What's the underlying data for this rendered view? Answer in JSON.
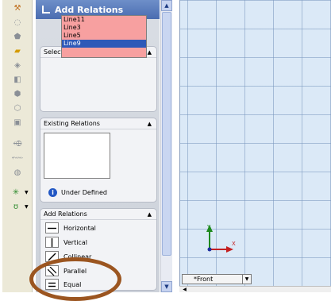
{
  "property_manager": {
    "title": "Add Relations",
    "buttons": {
      "ok": "✓",
      "help": "?",
      "detailed": "@"
    },
    "selected_entities": {
      "heading": "Selected Entities",
      "items": [
        "Line11",
        "Line3",
        "Line5",
        "Line9"
      ],
      "active_index": 3
    },
    "existing_relations": {
      "heading": "Existing Relations",
      "status": "Under Defined"
    },
    "add_relations": {
      "heading": "Add Relations",
      "items": [
        {
          "label": "Horizontal",
          "icon": "horizontal-line-icon"
        },
        {
          "label": "Vertical",
          "icon": "vertical-line-icon"
        },
        {
          "label": "Collinear",
          "icon": "collinear-icon"
        },
        {
          "label": "Parallel",
          "icon": "parallel-icon"
        },
        {
          "label": "Equal",
          "icon": "equal-icon"
        }
      ]
    }
  },
  "viewport": {
    "view_tab": "*Front",
    "axis_labels": {
      "y": "Y",
      "x": "X"
    }
  },
  "colors": {
    "header": "#4a6cb0",
    "selected_list": "#f7a0a0",
    "selection_highlight": "#2e59b8",
    "grid_background": "#dbe9f7",
    "annotation_oval": "#9b5520"
  }
}
